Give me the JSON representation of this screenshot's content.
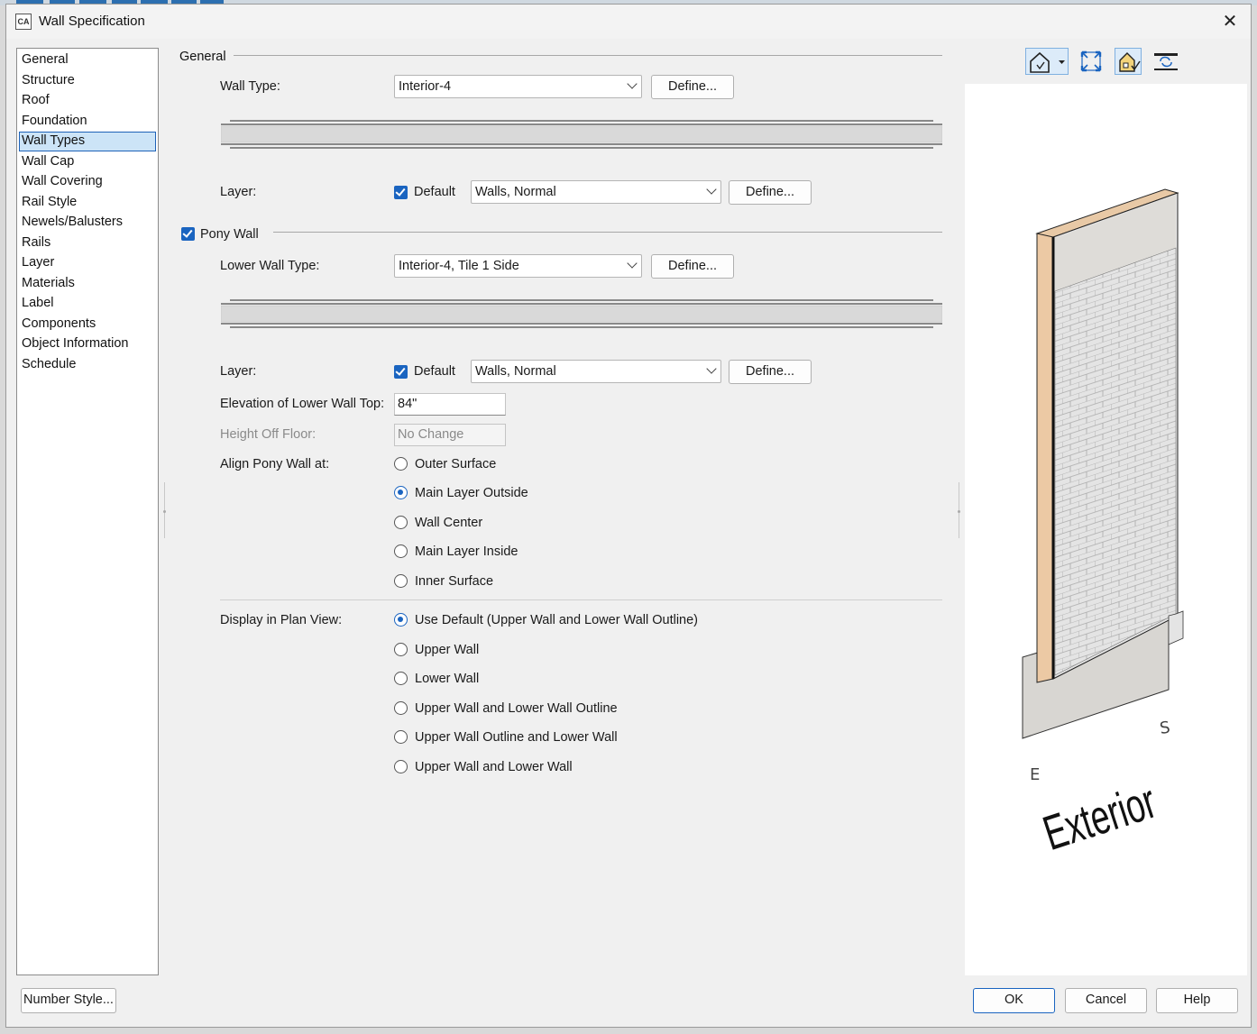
{
  "window": {
    "title": "Wall Specification"
  },
  "nav": {
    "items": [
      {
        "label": "General",
        "selected": false
      },
      {
        "label": "Structure",
        "selected": false
      },
      {
        "label": "Roof",
        "selected": false
      },
      {
        "label": "Foundation",
        "selected": false
      },
      {
        "label": "Wall Types",
        "selected": true
      },
      {
        "label": "Wall Cap",
        "selected": false
      },
      {
        "label": "Wall Covering",
        "selected": false
      },
      {
        "label": "Rail Style",
        "selected": false
      },
      {
        "label": "Newels/Balusters",
        "selected": false
      },
      {
        "label": "Rails",
        "selected": false
      },
      {
        "label": "Layer",
        "selected": false
      },
      {
        "label": "Materials",
        "selected": false
      },
      {
        "label": "Label",
        "selected": false
      },
      {
        "label": "Components",
        "selected": false
      },
      {
        "label": "Object Information",
        "selected": false
      },
      {
        "label": "Schedule",
        "selected": false
      }
    ]
  },
  "general": {
    "section_title": "General",
    "wall_type_label": "Wall Type:",
    "wall_type_value": "Interior-4",
    "define_label": "Define...",
    "layer_label": "Layer:",
    "default_label": "Default",
    "default_checked": true,
    "layer_value": "Walls,  Normal"
  },
  "pony": {
    "checkbox_label": "Pony Wall",
    "checked": true,
    "lower_wall_type_label": "Lower Wall Type:",
    "lower_wall_type_value": "Interior-4, Tile 1 Side",
    "define_label": "Define...",
    "layer_label": "Layer:",
    "default_label": "Default",
    "default_checked": true,
    "layer_value": "Walls,  Normal",
    "elevation_label": "Elevation of Lower Wall Top:",
    "elevation_value": "84\"",
    "height_label": "Height Off Floor:",
    "height_value": "No Change",
    "align_label": "Align Pony Wall at:",
    "align_options": [
      "Outer Surface",
      "Main Layer Outside",
      "Wall Center",
      "Main Layer Inside",
      "Inner Surface"
    ],
    "align_selected": "Main Layer Outside"
  },
  "plan_view": {
    "label": "Display in Plan View:",
    "options": [
      "Use Default (Upper Wall and Lower Wall Outline)",
      "Upper Wall",
      "Lower Wall",
      "Upper Wall and Lower Wall Outline",
      "Upper Wall Outline and Lower Wall",
      "Upper Wall and Lower Wall"
    ],
    "selected": "Use Default (Upper Wall and Lower Wall Outline)"
  },
  "preview": {
    "label_exterior": "Exterior",
    "direction_s": "S",
    "direction_e": "E",
    "toolbar_icons": [
      "camera-view-icon",
      "dropdown-arrow-icon",
      "fill-window-icon",
      "material-view-icon",
      "layer-icon"
    ]
  },
  "footer": {
    "number_style": "Number Style...",
    "ok": "OK",
    "cancel": "Cancel",
    "help": "Help"
  },
  "colors": {
    "accent": "#1a64c0",
    "selection_bg": "#cce4f7",
    "dialog_bg": "#f0f0f0",
    "wall_face": "#e3e3e3",
    "wall_edge": "#e8c9a6"
  }
}
